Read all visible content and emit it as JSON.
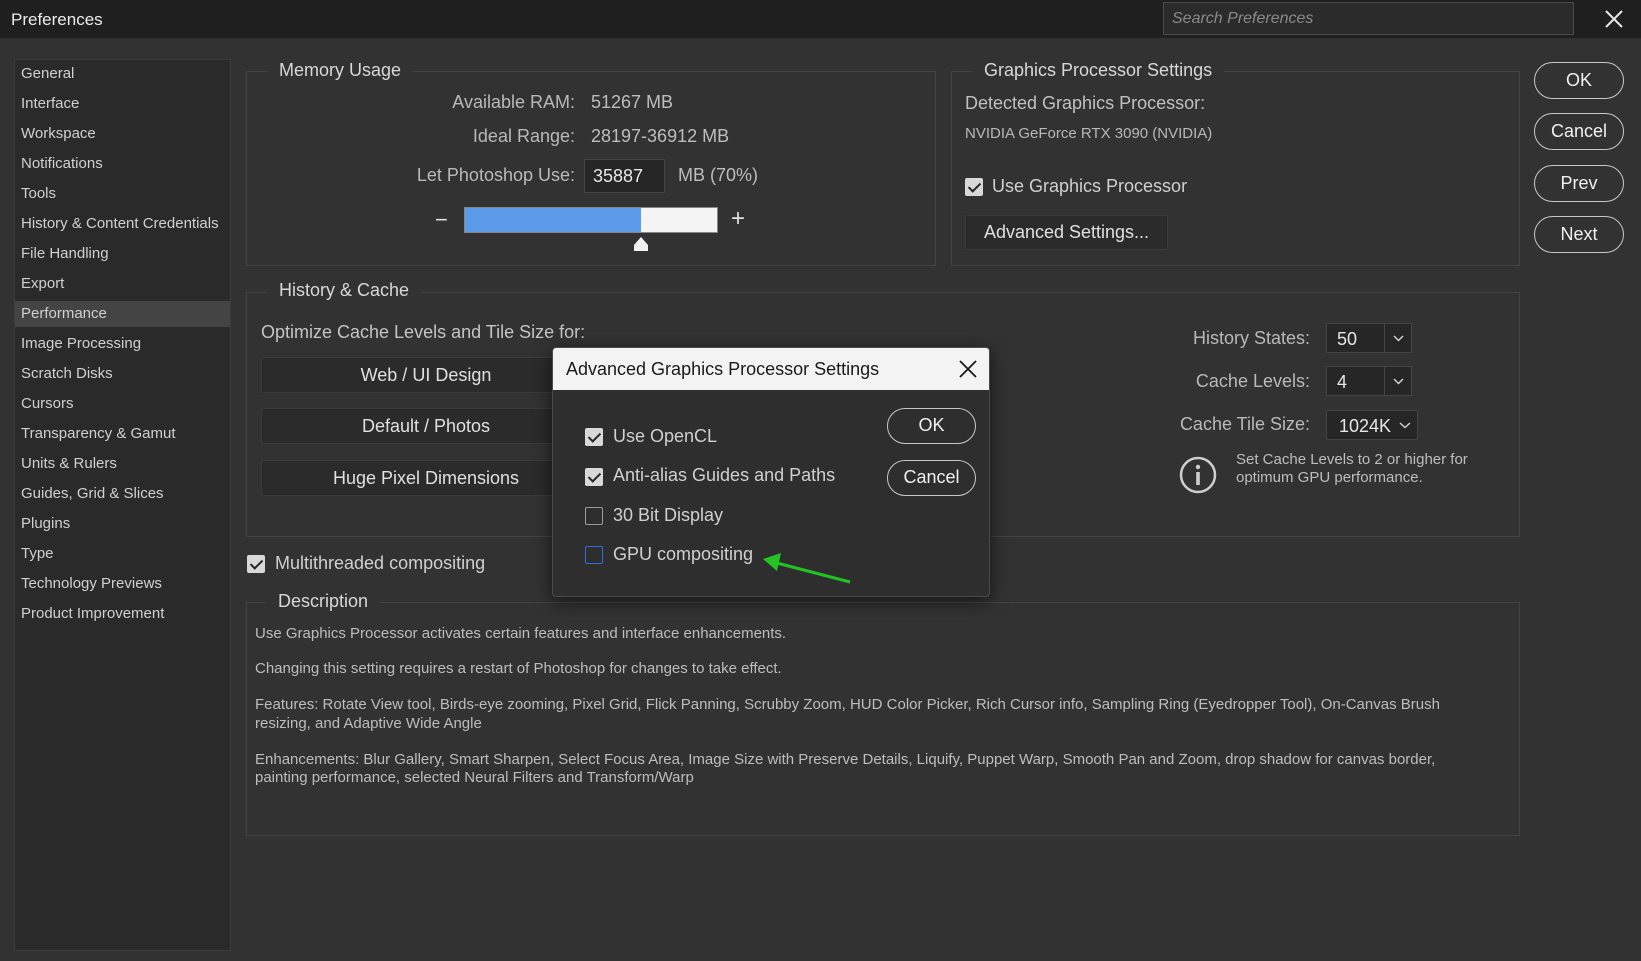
{
  "window": {
    "title": "Preferences",
    "search_placeholder": "Search Preferences"
  },
  "sidebar": {
    "items": [
      {
        "label": "General"
      },
      {
        "label": "Interface"
      },
      {
        "label": "Workspace"
      },
      {
        "label": "Notifications"
      },
      {
        "label": "Tools"
      },
      {
        "label": "History & Content Credentials"
      },
      {
        "label": "File Handling"
      },
      {
        "label": "Export"
      },
      {
        "label": "Performance",
        "active": true
      },
      {
        "label": "Image Processing"
      },
      {
        "label": "Scratch Disks"
      },
      {
        "label": "Cursors"
      },
      {
        "label": "Transparency & Gamut"
      },
      {
        "label": "Units & Rulers"
      },
      {
        "label": "Guides, Grid & Slices"
      },
      {
        "label": "Plugins"
      },
      {
        "label": "Type"
      },
      {
        "label": "Technology Previews"
      },
      {
        "label": "Product Improvement"
      }
    ]
  },
  "memory": {
    "title": "Memory Usage",
    "available_label": "Available RAM:",
    "available_value": "51267 MB",
    "ideal_label": "Ideal Range:",
    "ideal_value": "28197-36912 MB",
    "let_use_label": "Let Photoshop Use:",
    "let_use_value": "35887",
    "let_use_unit": "MB (70%)",
    "slider_fraction": 0.7,
    "minus": "−",
    "plus": "+"
  },
  "gpu": {
    "title": "Graphics Processor Settings",
    "detected_label": "Detected Graphics Processor:",
    "detected_value": "NVIDIA GeForce RTX 3090 (NVIDIA)",
    "use_gpu_label": "Use Graphics Processor",
    "use_gpu_checked": true,
    "advanced_button": "Advanced Settings..."
  },
  "side_buttons": {
    "ok": "OK",
    "cancel": "Cancel",
    "prev": "Prev",
    "next": "Next"
  },
  "history_cache": {
    "title": "History & Cache",
    "optimize_label": "Optimize Cache Levels and Tile Size for:",
    "preset_web": "Web / UI Design",
    "preset_default": "Default / Photos",
    "preset_huge": "Huge Pixel Dimensions",
    "history_states_label": "History States:",
    "history_states_value": "50",
    "cache_levels_label": "Cache Levels:",
    "cache_levels_value": "4",
    "tile_size_label": "Cache Tile Size:",
    "tile_size_value": "1024K",
    "info_line1": "Set Cache Levels to 2 or higher for",
    "info_line2": "optimum GPU performance."
  },
  "multithreaded": {
    "label": "Multithreaded compositing",
    "checked": true
  },
  "description": {
    "title": "Description",
    "para1": "Use Graphics Processor activates certain features and interface enhancements.",
    "para2": "Changing this setting requires a restart of Photoshop for changes to take effect.",
    "para3a": "Features: Rotate View tool, Birds-eye zooming, Pixel Grid, Flick Panning, Scrubby Zoom, HUD Color Picker, Rich Cursor info, Sampling Ring (Eyedropper Tool), On-Canvas Brush",
    "para3b": "resizing, and Adaptive Wide Angle",
    "para4a": "Enhancements: Blur Gallery, Smart Sharpen, Select Focus Area, Image Size with Preserve Details, Liquify, Puppet Warp, Smooth Pan and Zoom, drop shadow for canvas border,",
    "para4b": "painting performance, selected Neural Filters and Transform/Warp"
  },
  "modal": {
    "title": "Advanced Graphics Processor Settings",
    "opencl_label": "Use OpenCL",
    "opencl_checked": true,
    "antialias_label": "Anti-alias Guides and Paths",
    "antialias_checked": true,
    "bit30_label": "30 Bit Display",
    "bit30_checked": false,
    "gpu_comp_label": "GPU compositing",
    "gpu_comp_checked": false,
    "ok": "OK",
    "cancel": "Cancel"
  },
  "colors": {
    "slider_fill": "#5b9bea",
    "annotation_arrow": "#22c322"
  }
}
